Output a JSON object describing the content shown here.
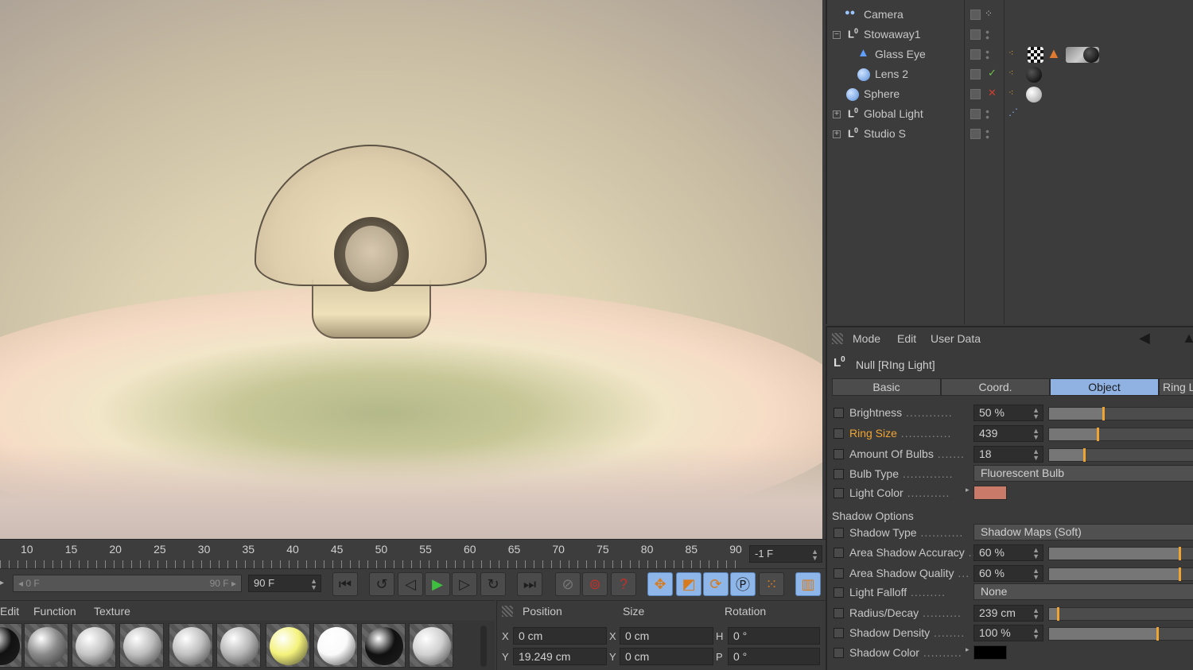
{
  "timeline": {
    "ticks": [
      "10",
      "15",
      "20",
      "25",
      "30",
      "35",
      "40",
      "45",
      "50",
      "55",
      "60",
      "65",
      "70",
      "75",
      "80",
      "85",
      "90"
    ],
    "current_frame": "-1 F"
  },
  "transport": {
    "range_start": "0 F",
    "range_end": "90 F",
    "end_frame": "90 F"
  },
  "materials": {
    "menu": [
      "Edit",
      "Function",
      "Texture"
    ],
    "swatches": [
      {
        "name": "black",
        "color": "#111111"
      },
      {
        "name": "glass",
        "color": "#8a8a8a"
      },
      {
        "name": "grey-1",
        "color": "#c4c4c4"
      },
      {
        "name": "grey-2",
        "color": "#bdbdbd"
      },
      {
        "name": "grey-3",
        "color": "#c0c0c0"
      },
      {
        "name": "grey-4",
        "color": "#b8b8b8"
      },
      {
        "name": "yellow",
        "color": "#f4f27a"
      },
      {
        "name": "white",
        "color": "#fafafa"
      },
      {
        "name": "black-2",
        "color": "#101010"
      },
      {
        "name": "chrome",
        "color": "#d0d0d0"
      }
    ]
  },
  "coord": {
    "headers": {
      "position": "Position",
      "size": "Size",
      "rotation": "Rotation"
    },
    "rows": [
      {
        "axis": "X",
        "pos": "0 cm",
        "size_axis": "X",
        "size": "0 cm",
        "rot_axis": "H",
        "rot": "0 °"
      },
      {
        "axis": "Y",
        "pos": "19.249 cm",
        "size_axis": "Y",
        "size": "0 cm",
        "rot_axis": "P",
        "rot": "0 °"
      }
    ]
  },
  "objects": [
    {
      "name": "Camera",
      "indent": 1
    },
    {
      "name": "Stowaway1",
      "indent": 1
    },
    {
      "name": "Glass Eye",
      "indent": 2
    },
    {
      "name": "Lens 2",
      "indent": 2
    },
    {
      "name": "Sphere",
      "indent": 1
    },
    {
      "name": "Global Light",
      "indent": 1
    },
    {
      "name": "Studio S",
      "indent": 1
    }
  ],
  "attr": {
    "menu": [
      "Mode",
      "Edit",
      "User Data"
    ],
    "title": "Null [RIng Light]",
    "tabs": [
      "Basic",
      "Coord.",
      "Object",
      "Ring L"
    ],
    "active_tab": "Object",
    "rows": [
      {
        "label": "Brightness",
        "value": "50 %",
        "fill": 0.37
      },
      {
        "label": "Ring Size",
        "value": "439",
        "fill": 0.33,
        "highlight": true
      },
      {
        "label": "Amount Of Bulbs",
        "value": "18",
        "fill": 0.24
      },
      {
        "label": "Bulb Type",
        "dropdown": "Fluorescent Bulb"
      },
      {
        "label": "Light Color",
        "color": "#c97a68"
      }
    ],
    "shadow_section": "Shadow Options",
    "shadow_rows": [
      {
        "label": "Shadow Type",
        "dropdown": "Shadow Maps (Soft)"
      },
      {
        "label": "Area Shadow Accuracy",
        "value": "60 %",
        "fill": 0.89
      },
      {
        "label": "Area Shadow Quality",
        "value": "60 %",
        "fill": 0.89
      },
      {
        "label": "Light Falloff",
        "dropdown": "None"
      },
      {
        "label": "Radius/Decay",
        "value": "239 cm",
        "fill": 0.06
      },
      {
        "label": "Shadow Density",
        "value": "100 %",
        "fill": 0.74
      },
      {
        "label": "Shadow Color",
        "color": "#000000"
      }
    ]
  }
}
